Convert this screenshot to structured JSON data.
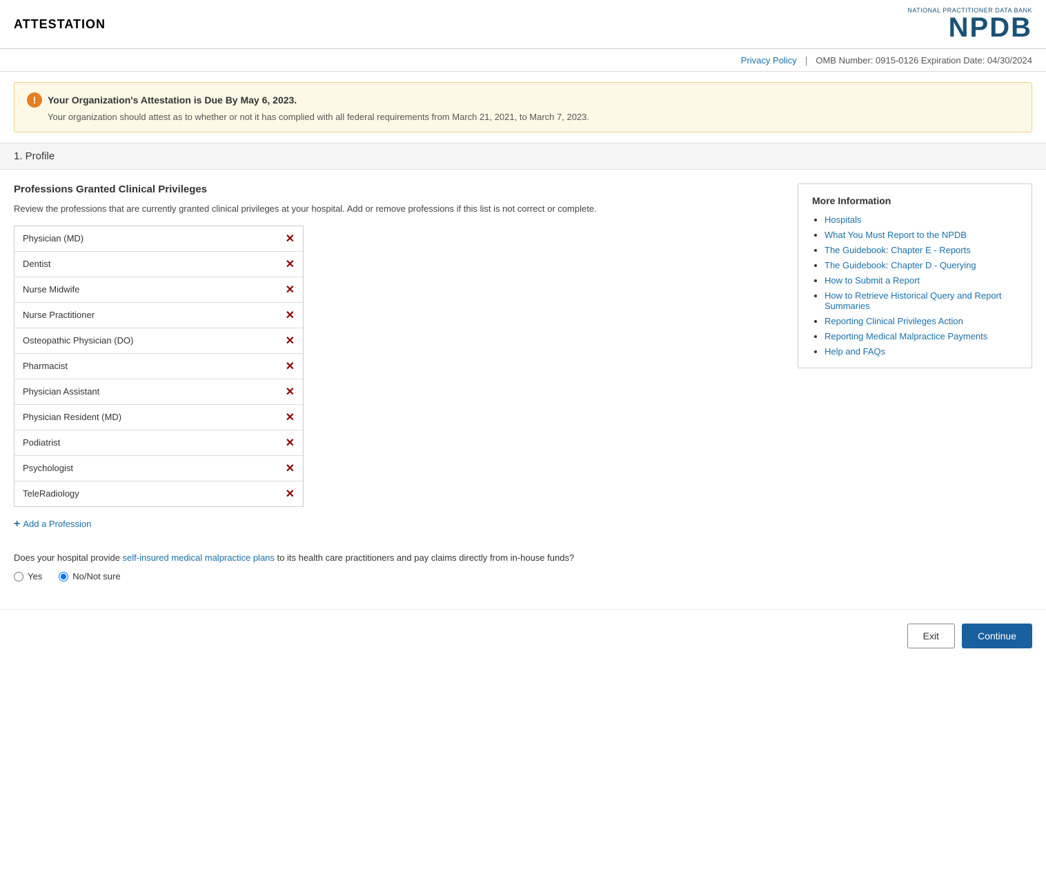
{
  "header": {
    "title": "ATTESTATION",
    "logo_top": "National Practitioner Data Bank",
    "logo_text": "NPDB"
  },
  "nav": {
    "privacy_label": "Privacy Policy",
    "separator": "|",
    "omb_text": "OMB Number: 0915-0126 Expiration Date: 04/30/2024"
  },
  "alert": {
    "title": "Your Organization's Attestation is Due By May 6, 2023.",
    "body": "Your organization should attest as to whether or not it has complied with all federal requirements from March 21, 2021, to March 7, 2023.",
    "icon": "!"
  },
  "section_header": "1. Profile",
  "professions": {
    "title": "Professions Granted Clinical Privileges",
    "description": "Review the professions that are currently granted clinical privileges at your hospital. Add or remove professions if this list is not correct or complete.",
    "items": [
      {
        "name": "Physician (MD)"
      },
      {
        "name": "Dentist"
      },
      {
        "name": "Nurse Midwife"
      },
      {
        "name": "Nurse Practitioner"
      },
      {
        "name": "Osteopathic Physician (DO)"
      },
      {
        "name": "Pharmacist"
      },
      {
        "name": "Physician Assistant"
      },
      {
        "name": "Physician Resident (MD)"
      },
      {
        "name": "Podiatrist"
      },
      {
        "name": "Psychologist"
      },
      {
        "name": "TeleRadiology"
      }
    ],
    "add_label": "Add a Profession",
    "remove_icon": "✕"
  },
  "question": {
    "text_before": "Does your hospital provide ",
    "link_text": "self-insured medical malpractice plans",
    "text_after": " to its health care practitioners and pay claims directly from in-house funds?",
    "options": [
      {
        "label": "Yes",
        "value": "yes",
        "checked": false
      },
      {
        "label": "No/Not sure",
        "value": "no",
        "checked": true
      }
    ]
  },
  "more_info": {
    "title": "More Information",
    "links": [
      {
        "label": "Hospitals"
      },
      {
        "label": "What You Must Report to the NPDB"
      },
      {
        "label": "The Guidebook: Chapter E - Reports"
      },
      {
        "label": "The Guidebook: Chapter D - Querying"
      },
      {
        "label": "How to Submit a Report"
      },
      {
        "label": "How to Retrieve Historical Query and Report Summaries"
      },
      {
        "label": "Reporting Clinical Privileges Action"
      },
      {
        "label": "Reporting Medical Malpractice Payments"
      },
      {
        "label": "Help and FAQs"
      }
    ]
  },
  "footer": {
    "exit_label": "Exit",
    "continue_label": "Continue"
  }
}
